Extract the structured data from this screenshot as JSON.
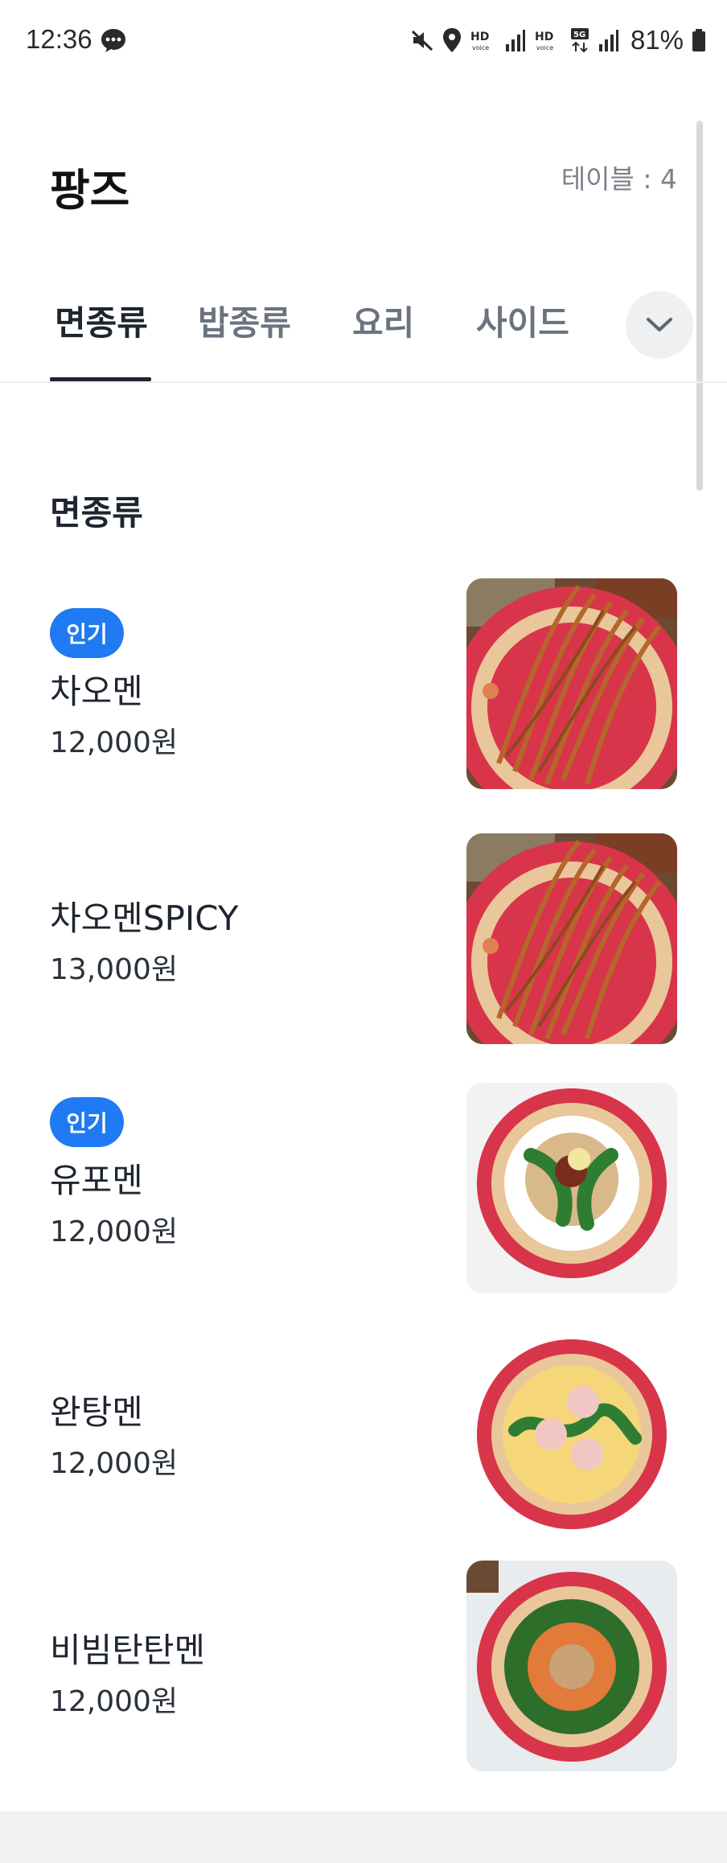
{
  "status_bar": {
    "time": "12:36",
    "battery": "81%",
    "icons": [
      "message-icon",
      "mute-icon",
      "location-icon",
      "hd-voice-icon",
      "signal-icon",
      "hd-voice-icon",
      "5g-icon",
      "signal-icon",
      "battery-icon"
    ]
  },
  "header": {
    "store_name": "팡즈",
    "table_label": "테이블 : 4"
  },
  "tabs": [
    {
      "label": "면종류",
      "active": true
    },
    {
      "label": "밥종류",
      "active": false
    },
    {
      "label": "요리",
      "active": false
    },
    {
      "label": "사이드",
      "active": false
    }
  ],
  "tabs_expand_icon": "chevron-down-icon",
  "section": {
    "title": "면종류"
  },
  "menu_items": [
    {
      "badge": "인기",
      "name": "차오멘",
      "price": "12,000원",
      "image": "stir-fried-noodles"
    },
    {
      "badge": "",
      "name": "차오멘SPICY",
      "price": "13,000원",
      "image": "stir-fried-noodles"
    },
    {
      "badge": "인기",
      "name": "유포멘",
      "price": "12,000원",
      "image": "noodles-with-greens"
    },
    {
      "badge": "",
      "name": "완탕멘",
      "price": "12,000원",
      "image": "wonton-noodle-soup"
    },
    {
      "badge": "",
      "name": "비빔탄탄멘",
      "price": "12,000원",
      "image": "spicy-dandan-noodles"
    }
  ],
  "colors": {
    "accent": "#1f7af3",
    "text_primary": "#1e2530",
    "text_secondary": "#6c7380",
    "plate_red": "#d8354a"
  }
}
